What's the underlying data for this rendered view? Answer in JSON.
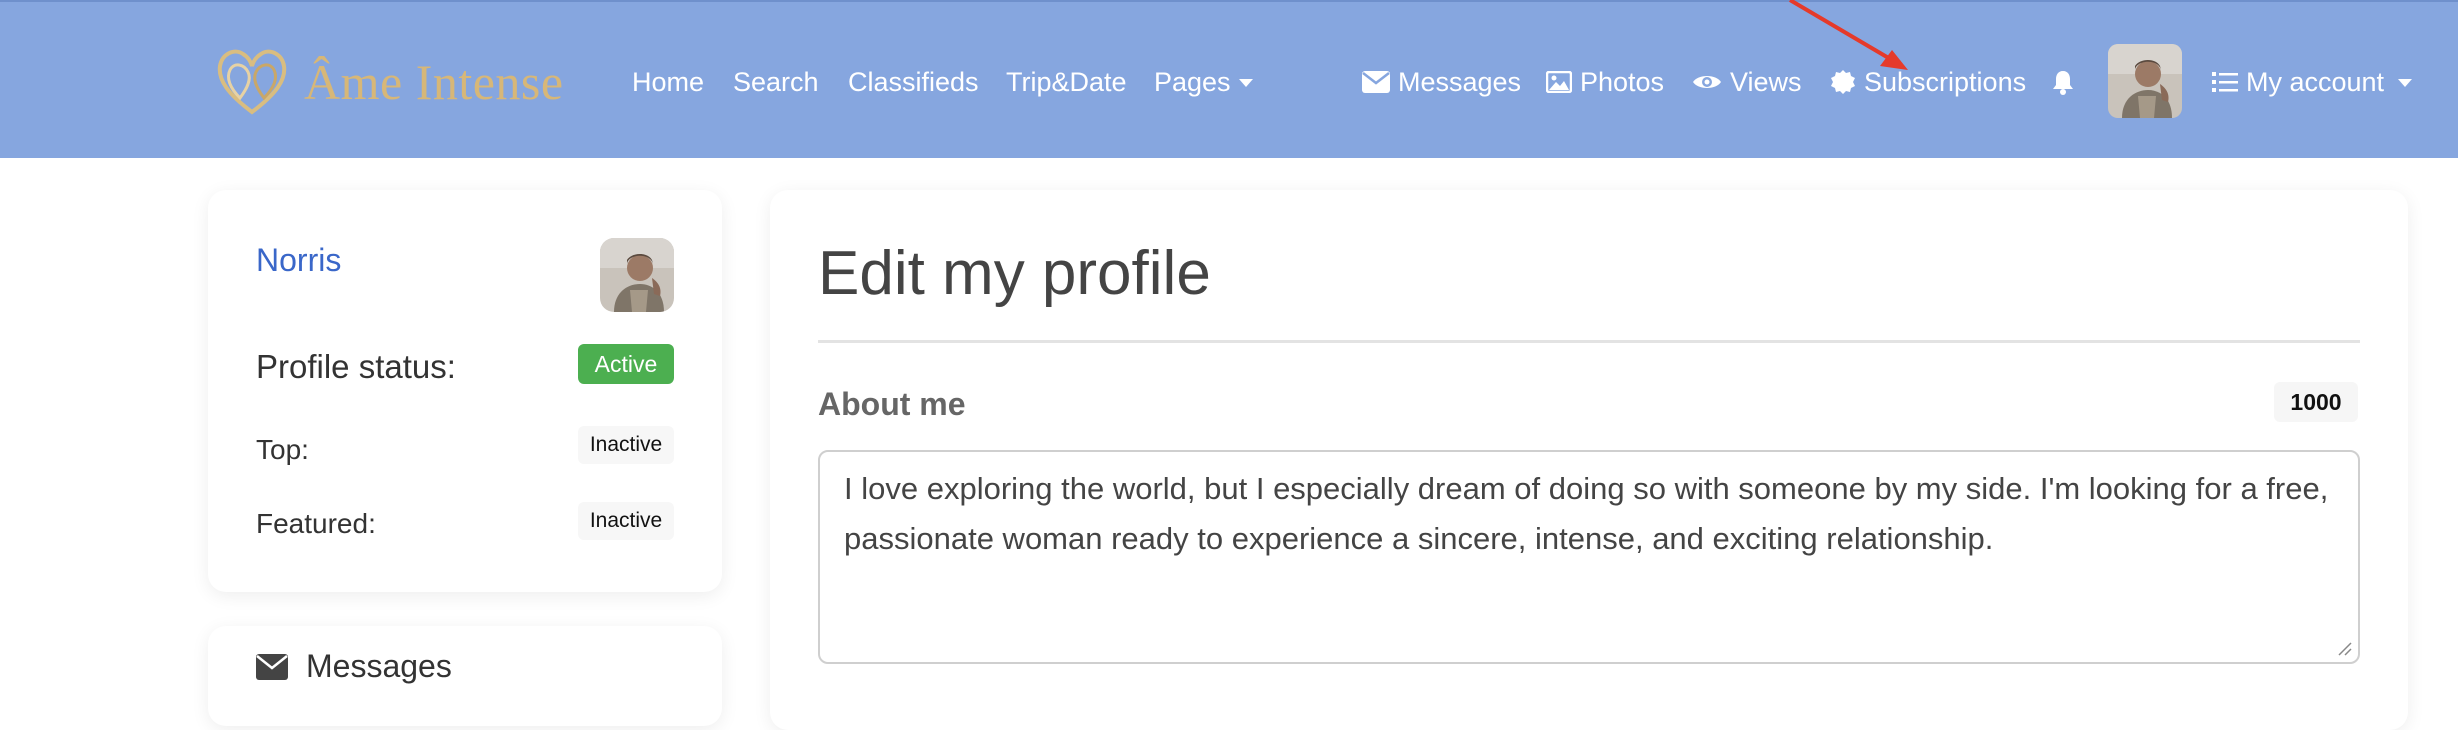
{
  "navbar": {
    "brand": "Âme Intense",
    "links": [
      {
        "label": "Home"
      },
      {
        "label": "Search"
      },
      {
        "label": "Classifieds"
      },
      {
        "label": "Trip&Date"
      },
      {
        "label": "Pages",
        "icon": "chevron-down-icon"
      }
    ],
    "right_links": [
      {
        "label": "Messages",
        "icon": "envelope-icon"
      },
      {
        "label": "Photos",
        "icon": "image-icon"
      },
      {
        "label": "Views",
        "icon": "eye-icon"
      },
      {
        "label": "Subscriptions",
        "icon": "badge-icon"
      }
    ],
    "notification_icon": "bell-icon",
    "account": {
      "label": "My account",
      "icon": "list-icon"
    },
    "colors": {
      "background": "#86a6df",
      "text": "#ffffff",
      "brand": "#d7b778"
    }
  },
  "annotation": {
    "type": "arrow",
    "color": "#e53a2a",
    "target": "Subscriptions"
  },
  "sidebar": {
    "user_name": "Norris",
    "profile_status_label": "Profile status:",
    "profile_status_value": "Active",
    "top_label": "Top:",
    "top_value": "Inactive",
    "featured_label": "Featured:",
    "featured_value": "Inactive",
    "messages_heading": "Messages",
    "colors": {
      "active": "#4caf50",
      "name": "#3a67c9"
    }
  },
  "main": {
    "title": "Edit my profile",
    "about_label": "About me",
    "char_count": "1000",
    "about_text": "I love exploring the world, but I especially dream of doing so with someone by my side. I'm looking for a free, passionate woman ready to experience a sincere, intense, and exciting relationship."
  }
}
